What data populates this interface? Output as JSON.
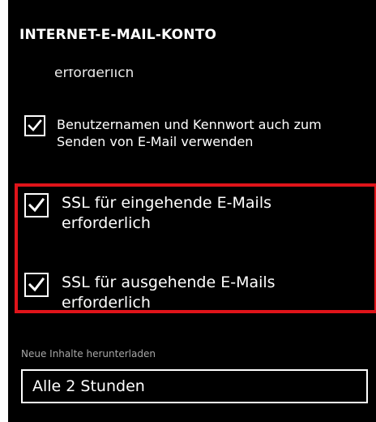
{
  "header": {
    "title": "INTERNET-E-MAIL-KONTO"
  },
  "scrolled_content": {
    "clipped_text": "erforderlich"
  },
  "options": {
    "use_credentials_for_send": {
      "label": "Benutzernamen und Kennwort auch zum Senden von E-Mail verwenden",
      "checked": true
    },
    "ssl_incoming": {
      "label": "SSL für eingehende E-Mails erforderlich",
      "checked": true
    },
    "ssl_outgoing": {
      "label": "SSL für ausgehende E-Mails erforderlich",
      "checked": true
    }
  },
  "download": {
    "label": "Neue Inhalte herunterladen",
    "selected_value": "Alle 2 Stunden"
  },
  "colors": {
    "background": "#000000",
    "text": "#ffffff",
    "highlight": "#e0141a",
    "muted_text": "#a8a8a8"
  }
}
